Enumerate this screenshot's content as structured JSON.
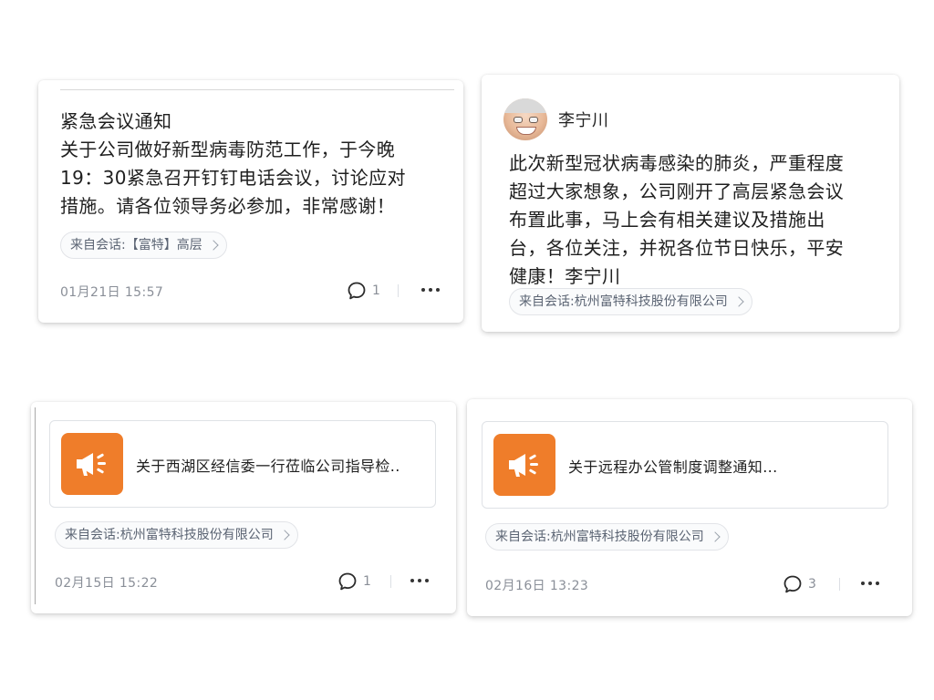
{
  "posts": [
    {
      "title": "紧急会议通知",
      "body_lines": [
        "关于公司做好新型病毒防范工作，于今晚",
        "19：30紧急召开钉钉电话会议，讨论应对",
        "措施。请各位领导务必参加，非常感谢！"
      ],
      "source": "来自会话:【富特】高层",
      "time": "01月21日 15:57",
      "comments": "1"
    },
    {
      "author": "李宁川",
      "body_lines": [
        "此次新型冠状病毒感染的肺炎，严重程度",
        "超过大家想象，公司刚开了高层紧急会议",
        "布置此事，马上会有相关建议及措施出",
        "台，各位关注，并祝各位节日快乐，平安",
        "健康！李宁川"
      ],
      "source": "来自会话:杭州富特科技股份有限公司"
    },
    {
      "notice_title": "关于西湖区经信委一行莅临公司指导检..",
      "source": "来自会话:杭州富特科技股份有限公司",
      "time": "02月15日 15:22",
      "comments": "1"
    },
    {
      "notice_title": "关于远程办公管制度调整通知...",
      "source": "来自会话:杭州富特科技股份有限公司",
      "time": "02月16日 13:23",
      "comments": "3"
    }
  ],
  "icons": {
    "comment": "comment-bubble-icon",
    "more": "more-dots-icon",
    "notice": "megaphone-icon",
    "chevron": "chevron-right-icon"
  },
  "colors": {
    "notice_icon_bg": "#ef7d2a",
    "text": "#1f1f1f",
    "muted": "#8a8f98"
  }
}
